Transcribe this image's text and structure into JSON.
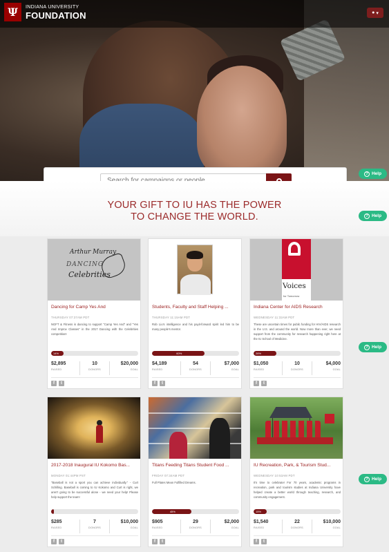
{
  "header": {
    "logo_mark": "Ψ",
    "logo_line1": "INDIANA UNIVERSITY",
    "logo_line2": "FOUNDATION",
    "user_menu_icon": "user-icon"
  },
  "search": {
    "placeholder": "Search for campaigns or people",
    "button_icon": "search-icon"
  },
  "help": {
    "label": "Help",
    "icon": "question-circle-icon"
  },
  "tagline": {
    "line1": "YOUR GIFT TO IU HAS THE POWER",
    "line2": "TO CHANGE THE WORLD."
  },
  "image_text": {
    "arthur_murray": "Arthur Murray",
    "dancing": "DANCING",
    "with_the": "with the",
    "celebrities": "Celebrities",
    "voices": "Voices",
    "voices_tag": "for Tomorrow"
  },
  "cards": [
    {
      "title": "Dancing for Camp Yes And",
      "date": "THURSDAY 07:37AM PDT",
      "description": "NGFT & Fitness is dancing to support \"Camp Yes And\" and \"Yes And Improv Classes\" in the 2017 Dancing with the Celebrities competition!",
      "progress_label": "14%",
      "progress": 0.14,
      "raised": "$2,895",
      "donors": "10",
      "goal": "$20,000",
      "raised_label": "RAISED",
      "donors_label": "DONORS",
      "goal_label": "GOAL"
    },
    {
      "title": "Students, Faculty and Staff Helping ...",
      "date": "THURSDAY 11:15AM PDT",
      "description": "Rob Liu's intelligence and his payit-forward spirit led him to be many people's mentor.",
      "progress_label": "60%",
      "progress": 0.6,
      "raised": "$4,189",
      "donors": "54",
      "goal": "$7,000",
      "raised_label": "RAISED",
      "donors_label": "DONORS",
      "goal_label": "GOAL"
    },
    {
      "title": "Indiana Center for AIDS Research",
      "date": "WEDNESDAY 11:32AM PDT",
      "description": "These are uncertain times for public funding for HIV/AIDS research in the U.S. and around the world. Now more than ever, we need support from the community for research happening right here at the IU School of Medicine.",
      "progress_label": "26%",
      "progress": 0.26,
      "raised": "$1,050",
      "donors": "10",
      "goal": "$4,000",
      "raised_label": "RAISED",
      "donors_label": "DONORS",
      "goal_label": "GOAL"
    },
    {
      "title": "2017-2018 Inaugural IU Kokomo Bas...",
      "date": "MONDAY 01:44PM PST",
      "description": "\"Baseball is not a sport you can achieve individually.\" - Curt Schilling. Baseball is coming to IU Kokomo and Curt is right, we aren't going to be successful alone - we need your help! Please help support the team!",
      "progress_label": "",
      "progress": 0.03,
      "raised": "$285",
      "donors": "7",
      "goal": "$10,000",
      "raised_label": "RAISED",
      "donors_label": "DONORS",
      "goal_label": "GOAL"
    },
    {
      "title": "Titans Feeding Titans Student Food ...",
      "date": "FRIDAY 07:34AM PDT",
      "description": "Full Plates Mean Fulfilled Dreams.",
      "progress_label": "45%",
      "progress": 0.45,
      "raised": "$905",
      "donors": "29",
      "goal": "$2,000",
      "raised_label": "RAISED",
      "donors_label": "DONORS",
      "goal_label": "GOAL"
    },
    {
      "title": "IU Recreation, Park, & Tourism Stud...",
      "date": "WEDNESDAY 10:53AM PDT",
      "description": "It's time to celebrate! For 70 years, academic programs in recreation, park and tourism studies at Indiana University have helped create a better world through teaching, research, and community engagement.",
      "progress_label": "15%",
      "progress": 0.15,
      "raised": "$1,540",
      "donors": "22",
      "goal": "$10,000",
      "raised_label": "RAISED",
      "donors_label": "DONORS",
      "goal_label": "GOAL"
    }
  ],
  "social": {
    "facebook": "f",
    "twitter": "t"
  },
  "colors": {
    "brand": "#990000",
    "accent": "#7a1416",
    "help": "#2bba85",
    "tagline": "#9b2a2a"
  }
}
